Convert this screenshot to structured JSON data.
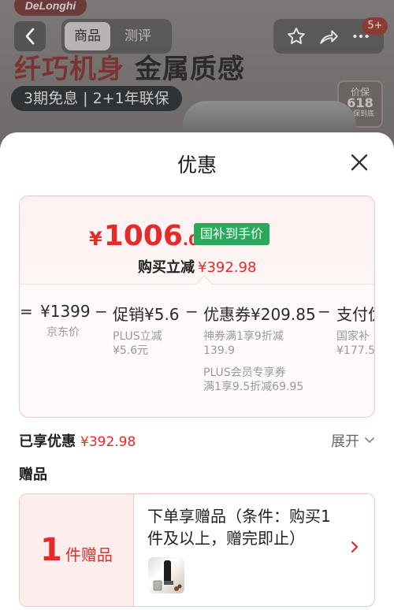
{
  "header": {
    "brand": "DeLonghi",
    "tabs": [
      "商品",
      "测评"
    ],
    "cart_badge": "5+",
    "hero_title_highlight": "纤巧机身",
    "hero_title_rest": "金属质感",
    "promo_pill": "3期免息 | 2+1年联保",
    "seal_top": "价保",
    "seal_big": "618",
    "seal_bottom": "价保到底"
  },
  "sheet": {
    "title": "优惠",
    "price": {
      "currency": "¥",
      "integer": "1006",
      "decimal": ".02",
      "tag": "国补到手价",
      "reduce_label": "购买立减",
      "reduce_value": "¥392.98"
    },
    "formula": {
      "ops": [
        "=",
        "−",
        "−",
        "−"
      ],
      "items": [
        {
          "head": "¥1399",
          "sub": [
            "京东价"
          ]
        },
        {
          "head": "促销¥5.6",
          "sub": [
            "PLUS立减",
            "¥5.6元"
          ]
        },
        {
          "head": "优惠券¥209.85",
          "sub": [
            "神券满1享9折减",
            "139.9",
            "",
            "PLUS会员专享券",
            "满1享9.5折减69.95"
          ]
        },
        {
          "head": "支付优",
          "sub": [
            "国家补",
            "¥177.5"
          ]
        }
      ]
    },
    "enjoyed_label": "已享优惠",
    "enjoyed_value": "¥392.98",
    "expand_label": "展开",
    "gift_section_title": "赠品",
    "gift": {
      "count": "1",
      "unit": "件赠品",
      "description": "下单享赠品（条件：购买1件及以上，赠完即止）"
    }
  },
  "colors": {
    "accent_red": "#e52a2a",
    "subsidy_green": "#2aa95d",
    "card_border": "#f3c4c6"
  },
  "icons": [
    "back-arrow-icon",
    "star-icon",
    "share-icon",
    "more-icon",
    "close-icon",
    "chevron-down-icon",
    "chevron-right-icon"
  ]
}
